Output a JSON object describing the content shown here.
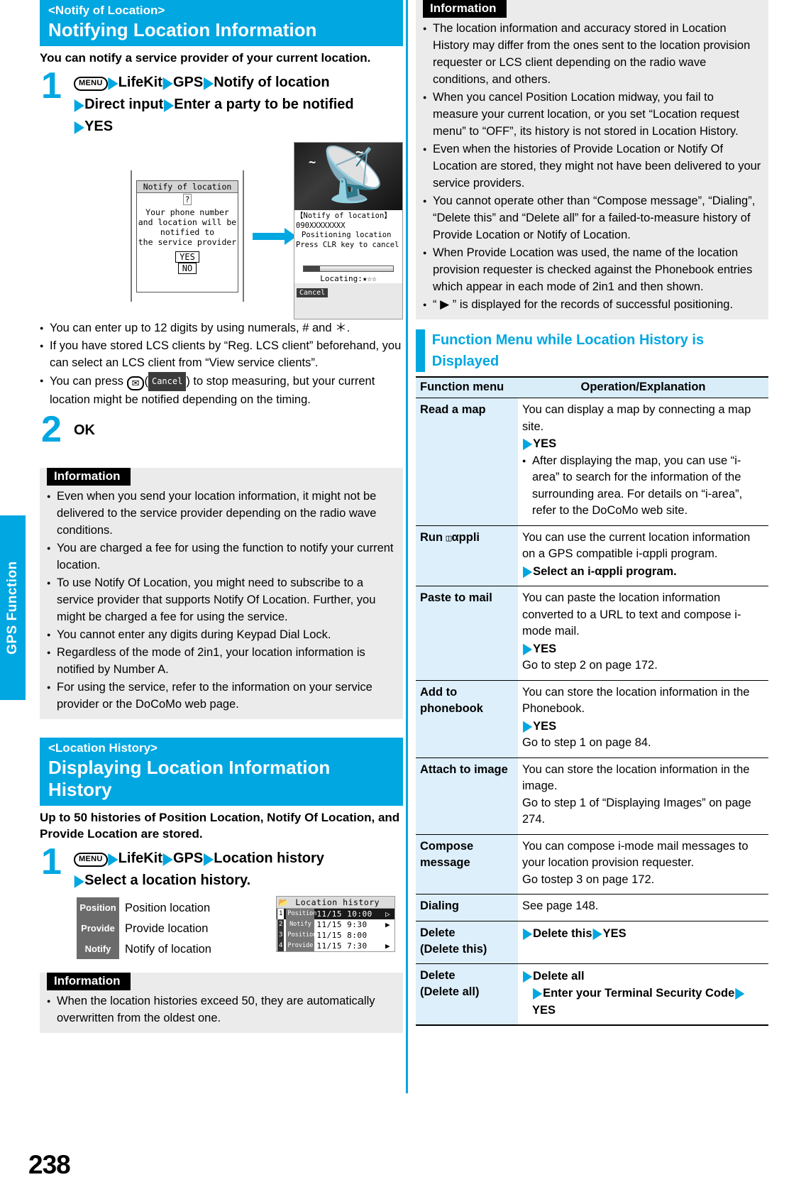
{
  "page": {
    "number": "238",
    "side_tab": "GPS Function"
  },
  "left": {
    "section1": {
      "sub_title": "<Notify of Location>",
      "main_title": "Notifying Location Information",
      "lead": "You can notify a service provider of your current location.",
      "step1": {
        "num": "1",
        "key": "MENU",
        "line1_a": "LifeKit",
        "line1_b": "GPS",
        "line1_c": "Notify of location",
        "line2_a": "Direct input",
        "line2_b": "Enter a party to be notified",
        "line3_a": "YES"
      },
      "screens": {
        "dialog": {
          "title": "Notify of location",
          "icon": "?",
          "line1": "Your phone number",
          "line2": "and location will be",
          "line3": "notified to",
          "line4": "the service provider",
          "yes": "YES",
          "no": "NO"
        },
        "locating": {
          "header": "【Notify of location】",
          "number": "090XXXXXXXX",
          "line1": "Positioning location",
          "line2": "Press CLR key to cancel",
          "status": "Locating:★☆☆",
          "softkey": "Cancel"
        }
      },
      "notes": [
        "You can enter up to 12 digits by using numerals, # and ＊.",
        "If you have stored LCS clients by “Reg. LCS client” beforehand, you can select an LCS client from “View service clients”.",
        "You can press"
      ],
      "note3_mid": "(",
      "note3_key": "Cancel",
      "note3_tail": ") to stop measuring, but your current location might be notified depending on the timing.",
      "step2": {
        "num": "2",
        "label": "OK"
      },
      "info": {
        "title": "Information",
        "items": [
          "Even when you send your location information, it might not be delivered to the service provider depending on the radio wave conditions.",
          "You are charged a fee for using the function to notify your current location.",
          "To use Notify Of Location, you might need to subscribe to a service provider that supports Notify Of Location. Further, you might be charged a fee for using the service.",
          "You cannot enter any digits during Keypad Dial Lock.",
          "Regardless of the mode of 2in1, your location information is notified by Number A.",
          "For using the service, refer to the information on your service provider or the DoCoMo web page."
        ]
      }
    },
    "section2": {
      "sub_title": "<Location History>",
      "main_title": "Displaying Location Information History",
      "lead": "Up to 50 histories of Position Location, Notify Of Location, and Provide Location are stored.",
      "step1": {
        "num": "1",
        "key": "MENU",
        "line1_a": "LifeKit",
        "line1_b": "GPS",
        "line1_c": "Location history",
        "line2_a": "Select a location history."
      },
      "legend": [
        {
          "tag": "Position",
          "label": "Position location"
        },
        {
          "tag": "Provide",
          "label": "Provide location"
        },
        {
          "tag": "Notify",
          "label": "Notify of location"
        }
      ],
      "history_screen": {
        "title": "Location history",
        "rows": [
          {
            "n": "1",
            "tag": "Position",
            "date": "11/15",
            "time": "10:00",
            "flag": "▷",
            "selected": true
          },
          {
            "n": "2",
            "tag": "Notify",
            "date": "11/15",
            "time": "9:30",
            "flag": "▶",
            "selected": false
          },
          {
            "n": "3",
            "tag": "Position",
            "date": "11/15",
            "time": "8:00",
            "flag": "",
            "selected": false
          },
          {
            "n": "4",
            "tag": "Provide",
            "date": "11/15",
            "time": "7:30",
            "flag": "▶",
            "selected": false
          }
        ]
      },
      "info": {
        "title": "Information",
        "items": [
          "When the location histories exceed 50, they are automatically overwritten from the oldest one."
        ]
      }
    }
  },
  "right": {
    "info": {
      "title": "Information",
      "items": [
        "The location information and accuracy stored in Location History may differ from the ones sent to the location provision requester or LCS client depending on the radio wave conditions, and others.",
        "When you cancel Position Location midway, you fail to measure your current location, or you set “Location request menu” to “OFF”, its history is not stored in Location History.",
        "Even when the histories of Provide Location or Notify Of Location are stored, they might not have been delivered to your service providers.",
        "You cannot operate other than “Compose message”, “Dialing”, “Delete this” and “Delete all” for a failed-to-measure history of Provide Location or Notify of Location.",
        "When Provide Location was used, the name of the location provision requester is checked against the Phonebook entries which appear in each mode of 2in1 and then shown."
      ],
      "last_prefix": "“",
      "last_flag": "▶",
      "last_suffix": "” is displayed for the records of successful positioning."
    },
    "fm_heading": "Function Menu while Location History is Displayed",
    "table": {
      "headers": [
        "Function menu",
        "Operation/Explanation"
      ],
      "rows": [
        {
          "name": "Read a map",
          "lines": [
            {
              "t": "You can display a map by connecting a map site.",
              "style": "plain"
            },
            {
              "t": "YES",
              "style": "arrow-bold"
            },
            {
              "t": "After displaying the map, you can use “i-area” to search for the information of the surrounding area. For details on “i-area”, refer to the DoCoMo web site.",
              "style": "bullet"
            }
          ]
        },
        {
          "name": "Run ℹ αppli",
          "name_html": true,
          "lines": [
            {
              "t": "You can use the current location information on a GPS compatible i-αppli program.",
              "style": "plain"
            },
            {
              "t": "Select an i-αppli program.",
              "style": "arrow-bold"
            }
          ]
        },
        {
          "name": "Paste to mail",
          "lines": [
            {
              "t": "You can paste the location information converted to a URL to text and compose i-mode mail.",
              "style": "plain"
            },
            {
              "t": "YES",
              "style": "arrow-bold"
            },
            {
              "t": "Go to step 2 on page 172.",
              "style": "plain"
            }
          ]
        },
        {
          "name": "Add to phonebook",
          "lines": [
            {
              "t": "You can store the location information in the Phonebook.",
              "style": "plain"
            },
            {
              "t": "YES",
              "style": "arrow-bold"
            },
            {
              "t": "Go to step 1 on page 84.",
              "style": "plain"
            }
          ]
        },
        {
          "name": "Attach to image",
          "lines": [
            {
              "t": "You can store the location information in the image.",
              "style": "plain"
            },
            {
              "t": "Go to step 1 of “Displaying Images” on page 274.",
              "style": "plain"
            }
          ]
        },
        {
          "name": "Compose message",
          "lines": [
            {
              "t": "You can compose i-mode mail messages to your location provision requester.",
              "style": "plain"
            },
            {
              "t": "Go tostep 3 on page 172.",
              "style": "plain"
            }
          ]
        },
        {
          "name": "Dialing",
          "lines": [
            {
              "t": "See page 148.",
              "style": "plain"
            }
          ]
        },
        {
          "name": "Delete (Delete this)",
          "lines": [
            {
              "t": "Delete this▶YES",
              "style": "arrow-bold"
            }
          ]
        },
        {
          "name": "Delete (Delete all)",
          "lines": [
            {
              "t": "Delete all",
              "style": "arrow-bold"
            },
            {
              "t": "Enter your Terminal Security Code▶YES",
              "style": "arrow-bold-ind"
            }
          ]
        }
      ]
    }
  }
}
